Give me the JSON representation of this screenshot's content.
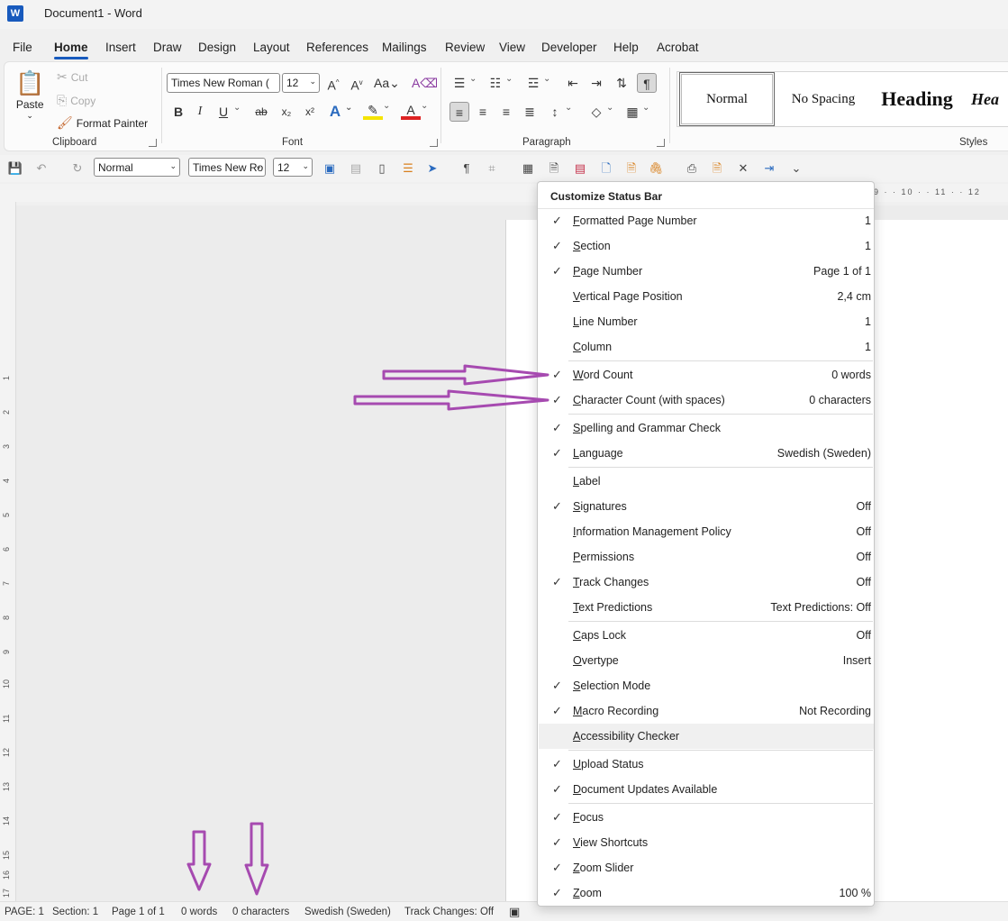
{
  "window": {
    "app_icon_letter": "W",
    "title": "Document1  -  Word"
  },
  "tabs": [
    "File",
    "Home",
    "Insert",
    "Draw",
    "Design",
    "Layout",
    "References",
    "Mailings",
    "Review",
    "View",
    "Developer",
    "Help",
    "Acrobat"
  ],
  "ribbon": {
    "clipboard": {
      "paste": "Paste",
      "cut": "Cut",
      "copy": "Copy",
      "format_painter": "Format Painter",
      "label": "Clipboard"
    },
    "font": {
      "font_name": "Times New Roman (",
      "font_size": "12",
      "label": "Font",
      "bold": "B",
      "italic": "I",
      "underline": "U",
      "strikethrough": "ab",
      "subscript": "x₂",
      "superscript": "x²"
    },
    "paragraph": {
      "label": "Paragraph"
    },
    "styles": {
      "label": "Styles",
      "items": [
        "Normal",
        "No Spacing",
        "Heading",
        "Hea"
      ]
    }
  },
  "qat": {
    "style_combo": "Normal",
    "font_combo": "Times New Ro",
    "size_combo": "12"
  },
  "ruler": {
    "top_marks": "9 · · 10 · · 11 · · 12",
    "vertical_marks": [
      "1",
      "2",
      "3",
      "4",
      "5",
      "6",
      "7",
      "8",
      "9",
      "10",
      "11",
      "12",
      "13",
      "14",
      "15",
      "16",
      "17"
    ]
  },
  "status_bar": {
    "page": "PAGE: 1",
    "section": "Section: 1",
    "page_of": "Page 1 of 1",
    "words": "0 words",
    "characters": "0 characters",
    "language": "Swedish (Sweden)",
    "track_changes": "Track Changes: Off"
  },
  "menu": {
    "title": "Customize Status Bar",
    "items": [
      {
        "label": "Formatted Page Number",
        "value": "1",
        "checked": true
      },
      {
        "label": "Section",
        "value": "1",
        "checked": true
      },
      {
        "label": "Page Number",
        "value": "Page 1 of 1",
        "checked": true
      },
      {
        "label": "Vertical Page Position",
        "value": "2,4 cm",
        "checked": false
      },
      {
        "label": "Line Number",
        "value": "1",
        "checked": false
      },
      {
        "label": "Column",
        "value": "1",
        "checked": false
      },
      {
        "label": "Word Count",
        "value": "0 words",
        "checked": true
      },
      {
        "label": "Character Count (with spaces)",
        "value": "0 characters",
        "checked": true
      },
      {
        "label": "Spelling and Grammar Check",
        "value": "",
        "checked": true
      },
      {
        "label": "Language",
        "value": "Swedish (Sweden)",
        "checked": true
      },
      {
        "label": "Label",
        "value": "",
        "checked": false
      },
      {
        "label": "Signatures",
        "value": "Off",
        "checked": true
      },
      {
        "label": "Information Management Policy",
        "value": "Off",
        "checked": false
      },
      {
        "label": "Permissions",
        "value": "Off",
        "checked": false
      },
      {
        "label": "Track Changes",
        "value": "Off",
        "checked": true
      },
      {
        "label": "Text Predictions",
        "value": "Text Predictions: Off",
        "checked": false
      },
      {
        "label": "Caps Lock",
        "value": "Off",
        "checked": false
      },
      {
        "label": "Overtype",
        "value": "Insert",
        "checked": false
      },
      {
        "label": "Selection Mode",
        "value": "",
        "checked": true
      },
      {
        "label": "Macro Recording",
        "value": "Not Recording",
        "checked": true
      },
      {
        "label": "Accessibility Checker",
        "value": "",
        "checked": false
      },
      {
        "label": "Upload Status",
        "value": "",
        "checked": true
      },
      {
        "label": "Document Updates Available",
        "value": "",
        "checked": true
      },
      {
        "label": "Focus",
        "value": "",
        "checked": true
      },
      {
        "label": "View Shortcuts",
        "value": "",
        "checked": true
      },
      {
        "label": "Zoom Slider",
        "value": "",
        "checked": true
      },
      {
        "label": "Zoom",
        "value": "100 %",
        "checked": true
      }
    ]
  },
  "colors": {
    "accent": "#185abd",
    "annotation_arrow": "#a64ab0"
  }
}
